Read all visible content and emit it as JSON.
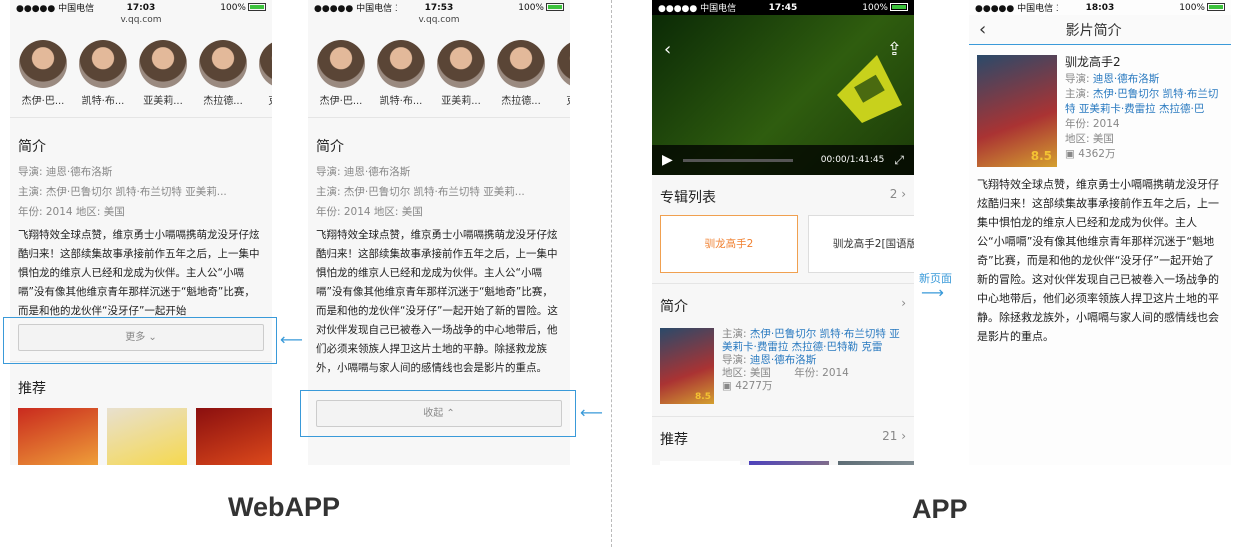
{
  "webapp_label": "WebAPP",
  "app_label": "APP",
  "new_page_label": "新页面",
  "phone1": {
    "status": {
      "carrier": "●●●●● 中国电信",
      "time": "17:03",
      "battery": "100%"
    },
    "url": "v.qq.com",
    "cast": [
      "杰伊·巴...",
      "凯特·布...",
      "亚美莉...",
      "杰拉德...",
      "克雷..."
    ],
    "intro_title": "简介",
    "director": "导演:  迪恩·德布洛斯",
    "actors": "主演:  杰伊·巴鲁切尔 凯特·布兰切特 亚美莉...",
    "year_region": "年份:  2014      地区:  美国",
    "desc": "飞翔特效全球点赞，维京勇士小嗝嗝携萌龙没牙仔炫酷归来！这部续集故事承接前作五年之后，上一集中惧怕龙的维京人已经和龙成为伙伴。主人公“小嗝嗝”没有像其他维京青年那样沉迷于“魁地奇”比赛，而是和他的龙伙伴“没牙仔”一起开始",
    "more": "更多",
    "rec_title": "推荐"
  },
  "phone2": {
    "status": {
      "carrier": "●●●●● 中国电信  3G",
      "time": "17:53",
      "battery": "100%"
    },
    "url": "v.qq.com",
    "cast": [
      "杰伊·巴...",
      "凯特·布...",
      "亚美莉...",
      "杰拉德...",
      "克雷..."
    ],
    "intro_title": "简介",
    "director": "导演:  迪恩·德布洛斯",
    "actors": "主演:  杰伊·巴鲁切尔 凯特·布兰切特 亚美莉...",
    "year_region": "年份:  2014      地区:  美国",
    "desc": "飞翔特效全球点赞，维京勇士小嗝嗝携萌龙没牙仔炫酷归来！这部续集故事承接前作五年之后，上一集中惧怕龙的维京人已经和龙成为伙伴。主人公“小嗝嗝”没有像其他维京青年那样沉迷于“魁地奇”比赛，而是和他的龙伙伴“没牙仔”一起开始了新的冒险。这对伙伴发现自己已被卷入一场战争的中心地带后，他们必须来领族人捍卫这片土地的平静。除拯救龙族外，小嗝嗝与家人间的感情线也会是影片的重点。",
    "collapse": "收起"
  },
  "phone3": {
    "status": {
      "carrier": "●●●●● 中国电信",
      "time": "17:45",
      "battery": "100%"
    },
    "time_display": "00:00/1:41:45",
    "album_title": "专辑列表",
    "album_count": "2",
    "albums": [
      "驯龙高手2",
      "驯龙高手2[国语版]"
    ],
    "intro_title": "简介",
    "actors_label": "主演:",
    "actors": "杰伊·巴鲁切尔 凯特·布兰切特 亚美莉卡·费雷拉 杰拉德·巴特勒 克雷",
    "director_label": "导演:",
    "director": "迪恩·德布洛斯",
    "region": "地区:  美国",
    "year": "年份:  2014",
    "plays": "4277万",
    "rating": "8.5",
    "rec_title": "推荐",
    "rec_count": "21"
  },
  "phone4": {
    "status": {
      "carrier": "●●●●● 中国电信  3G",
      "time": "18:03",
      "battery": "100%"
    },
    "title": "影片简介",
    "movie_name": "驯龙高手2",
    "director_label": "导演:",
    "director": "迪恩·德布洛斯",
    "actors_label": "主演:",
    "actors": "杰伊·巴鲁切尔 凯特·布兰切特 亚美莉卡·费雷拉 杰拉德·巴",
    "year": "年份:  2014",
    "region": "地区:  美国",
    "plays": "4362万",
    "rating": "8.5",
    "desc": "飞翔特效全球点赞，维京勇士小嗝嗝携萌龙没牙仔炫酷归来！这部续集故事承接前作五年之后，上一集中惧怕龙的维京人已经和龙成为伙伴。主人公“小嗝嗝”没有像其他维京青年那样沉迷于“魁地奇”比赛，而是和他的龙伙伴“没牙仔”一起开始了新的冒险。这对伙伴发现自己已被卷入一场战争的中心地带后，他们必须率领族人捍卫这片土地的平静。除拯救龙族外，小嗝嗝与家人间的感情线也会是影片的重点。"
  }
}
